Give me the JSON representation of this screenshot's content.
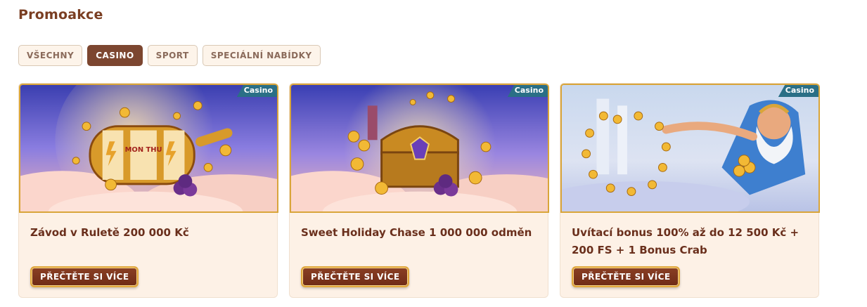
{
  "page": {
    "title": "Promoakce"
  },
  "filters": [
    {
      "label": "VŠECHNY",
      "active": false
    },
    {
      "label": "CASINO",
      "active": true
    },
    {
      "label": "SPORT",
      "active": false
    },
    {
      "label": "SPECIÁLNÍ NABÍDKY",
      "active": false
    }
  ],
  "cards": [
    {
      "badge": "Casino",
      "title": "Závod v Ruletě 200 000 Kč",
      "button": "PŘEČTĚTE SI VÍCE",
      "image_text": "MON THU"
    },
    {
      "badge": "Casino",
      "title": "Sweet Holiday Chase 1 000 000 odměn",
      "button": "PŘEČTĚTE SI VÍCE"
    },
    {
      "badge": "Casino",
      "title": "Uvítací bonus 100% až do 12 500 Kč + 200 FS + 1 Bonus Crab",
      "button": "PŘEČTĚTE SI VÍCE"
    }
  ],
  "colors": {
    "accent": "#7c4630",
    "badge": "#2a6f86",
    "card_bg": "#fdf1e6",
    "gold_border": "#d9a53a"
  }
}
